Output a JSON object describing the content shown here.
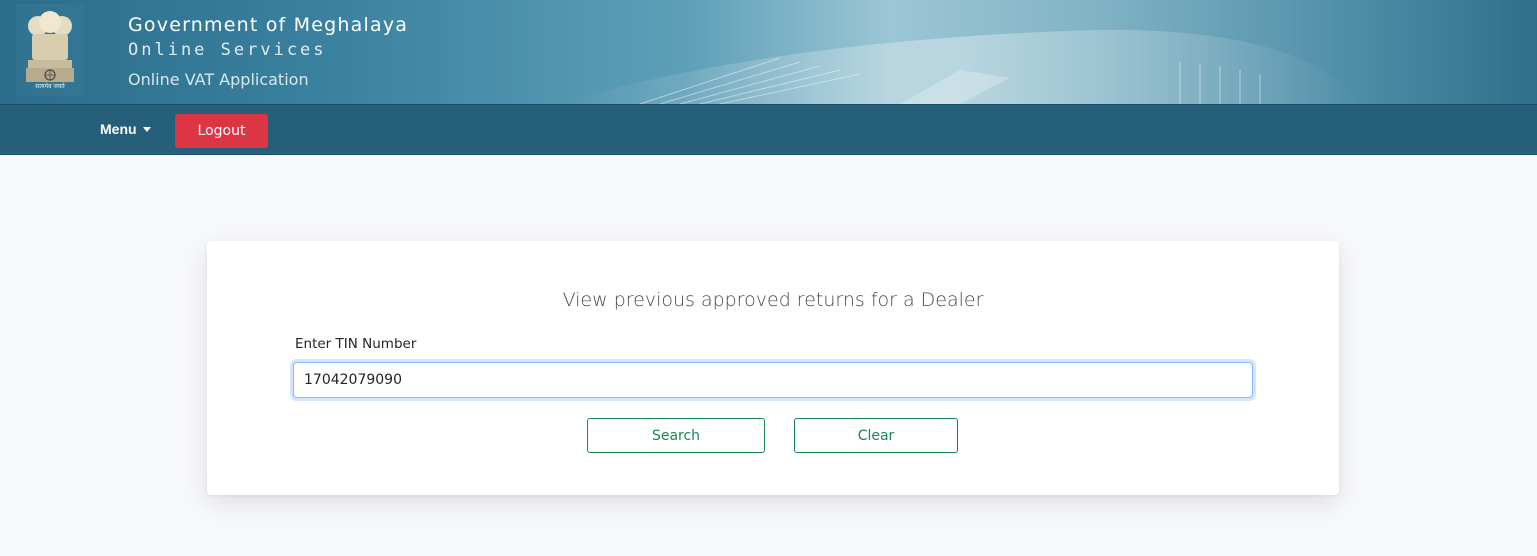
{
  "header": {
    "title": "Government of Meghalaya",
    "subtitle": "Online Services",
    "app_name": "Online VAT Application",
    "emblem_caption": "सत्यमेव जयते"
  },
  "navbar": {
    "menu_label": "Menu",
    "logout_label": "Logout"
  },
  "form": {
    "title": "View previous approved returns for a Dealer",
    "tin_label": "Enter TIN Number",
    "tin_value": "17042079090",
    "search_label": "Search",
    "clear_label": "Clear"
  },
  "colors": {
    "navbar": "#255f7a",
    "logout": "#dc3545",
    "outline_button": "#198754",
    "input_focus": "#86b7fe"
  },
  "icons": {
    "emblem": "state-emblem-icon",
    "menu_caret": "caret-down-icon"
  }
}
